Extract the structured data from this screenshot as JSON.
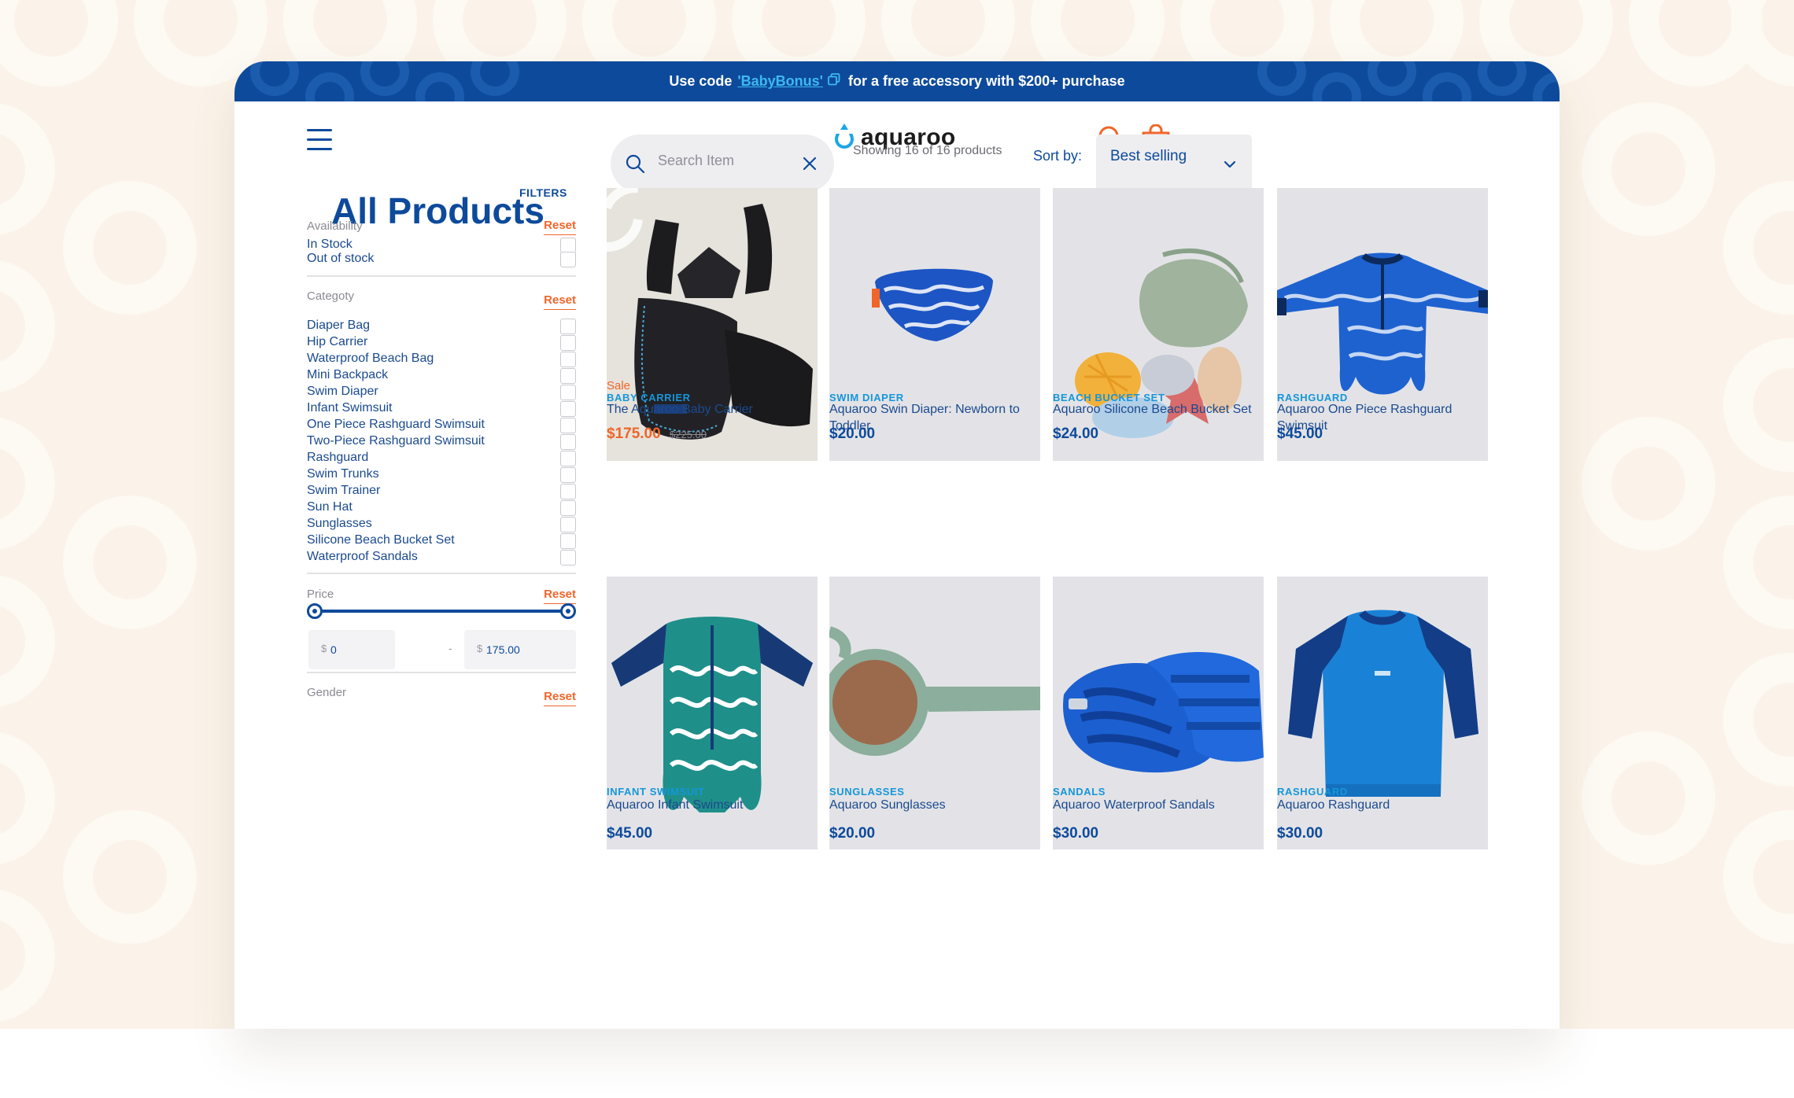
{
  "promo": {
    "prefix": "Use code ",
    "code": "'BabyBonus'",
    "suffix": "for a free accessory with $200+ purchase"
  },
  "header": {
    "logo_text": "aquaroo",
    "icons": [
      "menu-icon",
      "water-drop-logo-icon",
      "search-icon",
      "shopping-bag-icon"
    ]
  },
  "page": {
    "title": "All Products"
  },
  "search": {
    "placeholder": "Search Item",
    "value": ""
  },
  "results": {
    "showing": "Showing 16 of 16 products"
  },
  "sort": {
    "label": "Sort by:",
    "selected": "Best selling"
  },
  "filters": {
    "title": "FILTERS",
    "availability": {
      "heading": "Availability",
      "reset": "Reset",
      "options": [
        "In Stock",
        "Out of stock"
      ]
    },
    "category": {
      "heading": "Categoty",
      "reset": "Reset",
      "options": [
        "Diaper Bag",
        "Hip Carrier",
        "Waterproof Beach Bag",
        "Mini Backpack",
        "Swim Diaper",
        "Infant Swimsuit",
        "One Piece Rashguard Swimsuit",
        "Two-Piece Rashguard Swimsuit",
        "Rashguard",
        "Swim Trunks",
        "Swim Trainer",
        "Sun Hat",
        "Sunglasses",
        "Silicone Beach Bucket Set",
        "Waterproof Sandals"
      ]
    },
    "price": {
      "heading": "Price",
      "reset": "Reset",
      "currency": "$",
      "min": "0",
      "max": "175.00",
      "separator": "-",
      "range_selected_fraction": [
        0,
        1
      ]
    },
    "gender": {
      "heading": "Gender",
      "reset": "Reset"
    }
  },
  "products": [
    {
      "sale": "Sale",
      "category": "BABY CARRIER",
      "name": "The Aquaroo Baby Carrier",
      "price": "$175.00",
      "old_price": "$225.00",
      "image": "black-baby-carrier"
    },
    {
      "sale": "",
      "category": "SWIM DIAPER",
      "name": "Aquaroo Swin Diaper: Newborn to Toddler",
      "price": "$20.00",
      "old_price": "",
      "image": "blue-wave-swim-diaper"
    },
    {
      "sale": "",
      "category": "BEACH BUCKET SET",
      "name": "Aquaroo Silicone Beach Bucket Set",
      "price": "$24.00",
      "old_price": "",
      "image": "silicone-bucket-toys"
    },
    {
      "sale": "",
      "category": "RASHGUARD",
      "name": "Aquaroo One Piece Rashguard Swimsuit",
      "price": "$45.00",
      "old_price": "",
      "image": "one-piece-rashguard"
    },
    {
      "sale": "",
      "category": "INFANT SWIMSUIT",
      "name": "Aquaroo Infant Swimsuit",
      "price": "$45.00",
      "old_price": "",
      "image": "green-infant-swimsuit"
    },
    {
      "sale": "",
      "category": "SUNGLASSES",
      "name": "Aquaroo Sunglasses",
      "price": "$20.00",
      "old_price": "",
      "image": "green-sunglasses"
    },
    {
      "sale": "",
      "category": "SANDALS",
      "name": "Aquaroo Waterproof Sandals",
      "price": "$30.00",
      "old_price": "",
      "image": "blue-sandals"
    },
    {
      "sale": "",
      "category": "RASHGUARD",
      "name": "Aquaroo Rashguard",
      "price": "$30.00",
      "old_price": "",
      "image": "blue-rashguard-shirt"
    }
  ],
  "colors": {
    "brand_navy": "#0d4a9b",
    "accent_orange": "#f0652a",
    "category_blue": "#1596d9",
    "background_cream": "#fbf3e9"
  }
}
